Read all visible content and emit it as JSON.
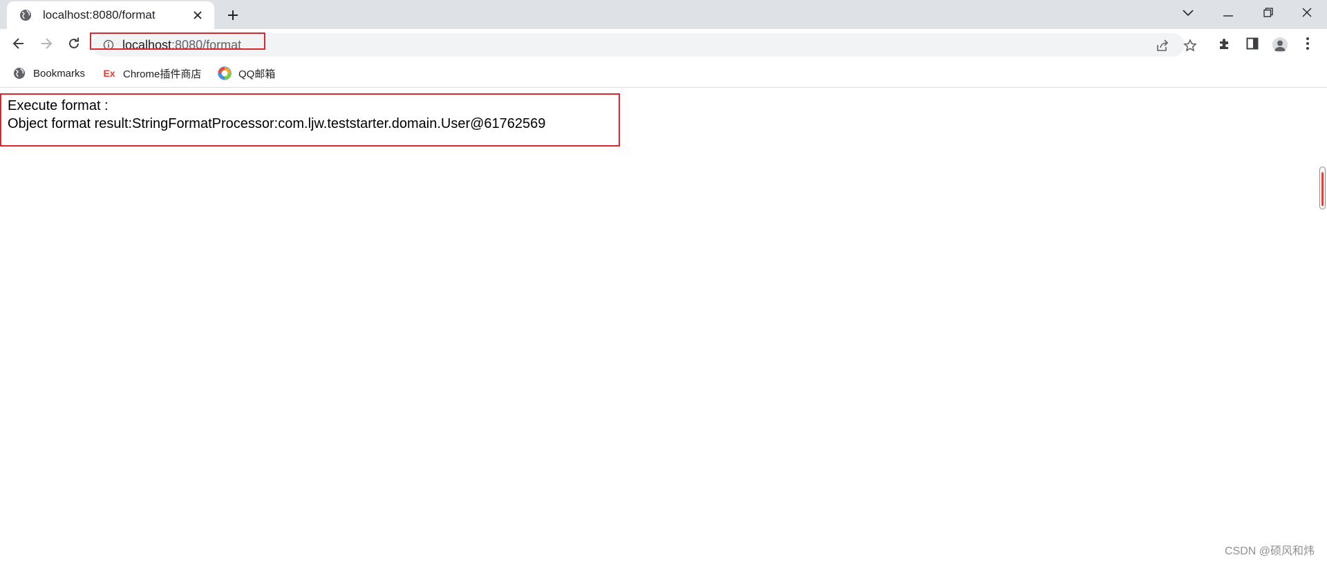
{
  "tab": {
    "title": "localhost:8080/format",
    "favicon": "globe-icon",
    "close_icon": "close-icon"
  },
  "tabstrip": {
    "new_tab_icon": "plus-icon",
    "controls": [
      "chevron-down-icon",
      "minimize-icon",
      "restore-icon",
      "close-icon"
    ]
  },
  "toolbar": {
    "back_icon": "arrow-left-icon",
    "forward_icon": "arrow-right-icon",
    "reload_icon": "reload-icon",
    "address": {
      "host": "localhost",
      "path": ":8080/format",
      "info_icon": "info-icon"
    },
    "right_icons": [
      "share-icon",
      "star-icon",
      "puzzle-icon",
      "side-panel-icon",
      "profile-icon",
      "kebab-menu-icon"
    ]
  },
  "bookmarks": [
    {
      "label": "Bookmarks",
      "icon": "globe-icon"
    },
    {
      "label": "Chrome插件商店",
      "icon": "ex-logo",
      "icon_text": "Ex"
    },
    {
      "label": "QQ邮箱",
      "icon": "qq-mail-icon"
    }
  ],
  "page": {
    "line1": "Execute format :",
    "line2": "Object format result:StringFormatProcessor:com.ljw.teststarter.domain.User@61762569"
  },
  "watermark": "CSDN @硕风和炜",
  "colors": {
    "highlight_border": "#d9262e",
    "tabstrip_bg": "#dee1e6",
    "omnibox_bg": "#f1f3f4"
  }
}
